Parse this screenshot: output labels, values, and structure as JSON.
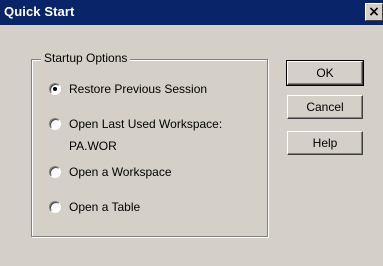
{
  "window": {
    "title": "Quick Start",
    "close_glyph": "×"
  },
  "group": {
    "label": "Startup Options",
    "options": [
      {
        "label": "Restore Previous Session",
        "checked": true
      },
      {
        "label": "Open Last Used Workspace:",
        "sublabel": "PA.WOR",
        "checked": false
      },
      {
        "label": "Open a Workspace",
        "checked": false
      },
      {
        "label": "Open a Table",
        "checked": false
      }
    ]
  },
  "buttons": {
    "ok": "OK",
    "cancel": "Cancel",
    "help": "Help"
  },
  "colors": {
    "titlebar": "#0a246a",
    "face": "#d4d0c8"
  }
}
